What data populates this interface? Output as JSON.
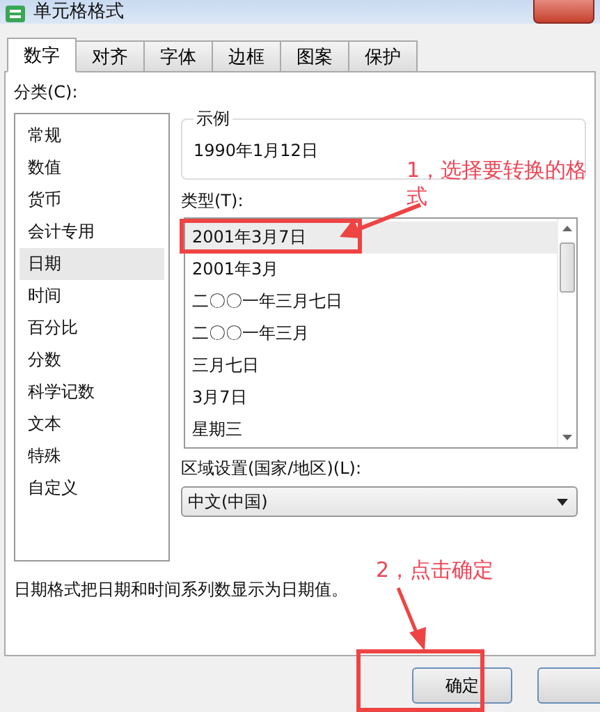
{
  "window": {
    "title": "单元格格式"
  },
  "tabs": [
    {
      "label": "数字",
      "selected": true
    },
    {
      "label": "对齐",
      "selected": false
    },
    {
      "label": "字体",
      "selected": false
    },
    {
      "label": "边框",
      "selected": false
    },
    {
      "label": "图案",
      "selected": false
    },
    {
      "label": "保护",
      "selected": false
    }
  ],
  "category": {
    "label": "分类(C):",
    "items": [
      {
        "label": "常规",
        "selected": false
      },
      {
        "label": "数值",
        "selected": false
      },
      {
        "label": "货币",
        "selected": false
      },
      {
        "label": "会计专用",
        "selected": false
      },
      {
        "label": "日期",
        "selected": true
      },
      {
        "label": "时间",
        "selected": false
      },
      {
        "label": "百分比",
        "selected": false
      },
      {
        "label": "分数",
        "selected": false
      },
      {
        "label": "科学记数",
        "selected": false
      },
      {
        "label": "文本",
        "selected": false
      },
      {
        "label": "特殊",
        "selected": false
      },
      {
        "label": "自定义",
        "selected": false
      }
    ]
  },
  "sample": {
    "legend": "示例",
    "value": "1990年1月12日"
  },
  "type": {
    "label": "类型(T):",
    "items": [
      {
        "label": "2001年3月7日",
        "selected": true
      },
      {
        "label": "2001年3月",
        "selected": false
      },
      {
        "label": "二〇〇一年三月七日",
        "selected": false
      },
      {
        "label": "二〇〇一年三月",
        "selected": false
      },
      {
        "label": "三月七日",
        "selected": false
      },
      {
        "label": "3月7日",
        "selected": false
      },
      {
        "label": "星期三",
        "selected": false
      }
    ]
  },
  "locale": {
    "label": "区域设置(国家/地区)(L):",
    "value": "中文(中国)"
  },
  "description": "日期格式把日期和时间系列数显示为日期值。",
  "ok_button": {
    "label": "确定"
  },
  "annotations": [
    {
      "text": "1，选择要转换的格式"
    },
    {
      "text": "2，点击确定"
    }
  ]
}
